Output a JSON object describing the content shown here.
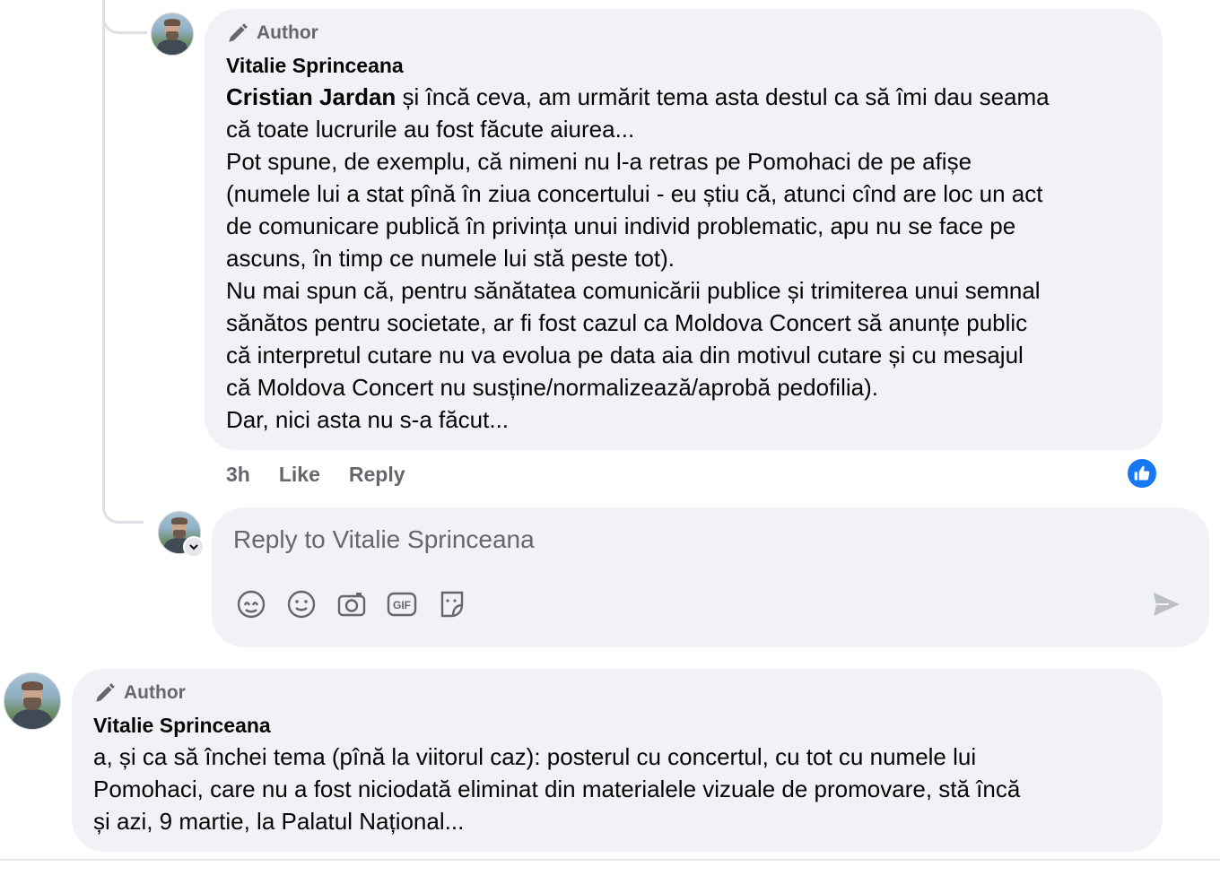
{
  "comment1": {
    "badge": "Author",
    "author": "Vitalie Sprinceana",
    "mention": "Cristian Jardan",
    "text": " și încă ceva, am urmărit tema asta destul ca să îmi dau seama\ncă toate lucrurile au fost făcute aiurea...\nPot spune, de exemplu, că nimeni nu l-a retras pe Pomohaci de pe afișe\n(numele lui a stat pînă în ziua concertului - eu știu că, atunci cînd are loc un act\nde comunicare publică în privința unui individ problematic, apu nu se face pe\nascuns, în timp ce numele lui stă peste tot).\nNu mai spun că, pentru sănătatea comunicării publice și trimiterea unui semnal\nsănătos pentru societate, ar fi fost cazul ca Moldova Concert să anunțe public\ncă interpretul cutare nu va evolua pe data aia din motivul cutare și cu mesajul\ncă Moldova Concert nu susține/normalizează/aprobă pedofilia).\nDar, nici asta nu s-a făcut...",
    "time": "3h",
    "like_label": "Like",
    "reply_label": "Reply"
  },
  "reply_box": {
    "placeholder": "Reply to Vitalie Sprinceana",
    "tools": [
      "avatar-sticker-icon",
      "emoji-icon",
      "camera-icon",
      "gif-icon",
      "sticker-icon"
    ],
    "send_icon": "send-icon"
  },
  "comment2": {
    "badge": "Author",
    "author": "Vitalie Sprinceana",
    "text": "a, și ca să închei tema (pînă la viitorul caz): posterul cu concertul, cu tot cu numele lui\nPomohaci, care nu a fost niciodată eliminat din materialele vizuale de promovare, stă încă\nși azi, 9 martie, la Palatul Național..."
  },
  "colors": {
    "bubble": "#f0f2f5",
    "meta_text": "#65676b",
    "like_blue": "#1877f2"
  }
}
